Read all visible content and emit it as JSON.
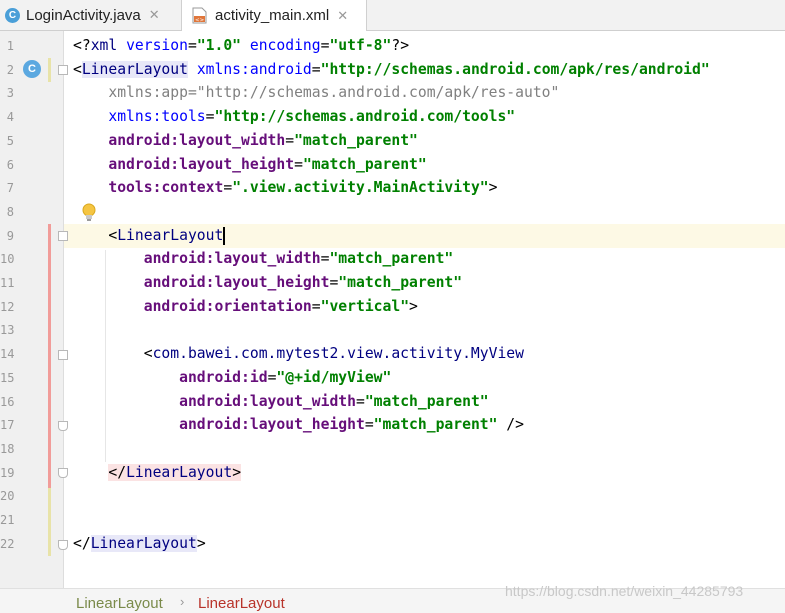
{
  "tabs": [
    {
      "label": "LoginActivity.java",
      "icon": "java-class-icon",
      "active": false
    },
    {
      "label": "activity_main.xml",
      "icon": "xml-file-icon",
      "active": true
    }
  ],
  "lines": [
    {
      "num": "1",
      "parts": [
        {
          "t": "<?",
          "c": "punc"
        },
        {
          "t": "xml ",
          "c": "tag"
        },
        {
          "t": "version",
          "c": "attr"
        },
        {
          "t": "=",
          "c": "punc"
        },
        {
          "t": "\"1.0\"",
          "c": "val"
        },
        {
          "t": " ",
          "c": "punc"
        },
        {
          "t": "encoding",
          "c": "attr"
        },
        {
          "t": "=",
          "c": "punc"
        },
        {
          "t": "\"utf-8\"",
          "c": "val"
        },
        {
          "t": "?>",
          "c": "punc"
        }
      ]
    },
    {
      "num": "2",
      "parts": [
        {
          "t": "<",
          "c": "punc"
        },
        {
          "t": "LinearLayout",
          "c": "tag",
          "bg": "tagbg"
        },
        {
          "t": " ",
          "c": "punc"
        },
        {
          "t": "xmlns:android",
          "c": "attr"
        },
        {
          "t": "=",
          "c": "punc"
        },
        {
          "t": "\"http://schemas.android.com/apk/res/android\"",
          "c": "val"
        }
      ]
    },
    {
      "num": "3",
      "parts": [
        {
          "t": "    xmlns:app=\"http://schemas.android.com/apk/res-auto\"",
          "c": "gray"
        }
      ]
    },
    {
      "num": "4",
      "parts": [
        {
          "t": "    ",
          "c": "punc"
        },
        {
          "t": "xmlns:tools",
          "c": "attr"
        },
        {
          "t": "=",
          "c": "punc"
        },
        {
          "t": "\"http://schemas.android.com/tools\"",
          "c": "val"
        }
      ]
    },
    {
      "num": "5",
      "parts": [
        {
          "t": "    ",
          "c": "punc"
        },
        {
          "t": "android:",
          "c": "attrns"
        },
        {
          "t": "layout_width",
          "c": "attrns"
        },
        {
          "t": "=",
          "c": "punc"
        },
        {
          "t": "\"match_parent\"",
          "c": "val"
        }
      ]
    },
    {
      "num": "6",
      "parts": [
        {
          "t": "    ",
          "c": "punc"
        },
        {
          "t": "android:",
          "c": "attrns"
        },
        {
          "t": "layout_height",
          "c": "attrns"
        },
        {
          "t": "=",
          "c": "punc"
        },
        {
          "t": "\"match_parent\"",
          "c": "val"
        }
      ]
    },
    {
      "num": "7",
      "parts": [
        {
          "t": "    ",
          "c": "punc"
        },
        {
          "t": "tools:",
          "c": "attrns"
        },
        {
          "t": "context",
          "c": "attrns"
        },
        {
          "t": "=",
          "c": "punc"
        },
        {
          "t": "\".view.activity.MainActivity\"",
          "c": "val"
        },
        {
          "t": ">",
          "c": "punc"
        }
      ]
    },
    {
      "num": "8",
      "parts": []
    },
    {
      "num": "9",
      "parts": [
        {
          "t": "    <",
          "c": "punc"
        },
        {
          "t": "LinearLayout",
          "c": "tag"
        },
        {
          "t": "",
          "c": "caret"
        }
      ]
    },
    {
      "num": "10",
      "parts": [
        {
          "t": "        ",
          "c": "punc"
        },
        {
          "t": "android:layout_width",
          "c": "attrns"
        },
        {
          "t": "=",
          "c": "punc"
        },
        {
          "t": "\"match_parent\"",
          "c": "val"
        }
      ]
    },
    {
      "num": "11",
      "parts": [
        {
          "t": "        ",
          "c": "punc"
        },
        {
          "t": "android:layout_height",
          "c": "attrns"
        },
        {
          "t": "=",
          "c": "punc"
        },
        {
          "t": "\"match_parent\"",
          "c": "val"
        }
      ]
    },
    {
      "num": "12",
      "parts": [
        {
          "t": "        ",
          "c": "punc"
        },
        {
          "t": "android:orientation",
          "c": "attrns"
        },
        {
          "t": "=",
          "c": "punc"
        },
        {
          "t": "\"vertical\"",
          "c": "val"
        },
        {
          "t": ">",
          "c": "punc"
        }
      ]
    },
    {
      "num": "13",
      "parts": []
    },
    {
      "num": "14",
      "parts": [
        {
          "t": "        <",
          "c": "punc"
        },
        {
          "t": "com.bawei.com.mytest2.view.activity.MyView",
          "c": "tag"
        }
      ]
    },
    {
      "num": "15",
      "parts": [
        {
          "t": "            ",
          "c": "punc"
        },
        {
          "t": "android:id",
          "c": "attrns"
        },
        {
          "t": "=",
          "c": "punc"
        },
        {
          "t": "\"@+id/myView\"",
          "c": "val"
        }
      ]
    },
    {
      "num": "16",
      "parts": [
        {
          "t": "            ",
          "c": "punc"
        },
        {
          "t": "android:layout_width",
          "c": "attrns"
        },
        {
          "t": "=",
          "c": "punc"
        },
        {
          "t": "\"match_parent\"",
          "c": "val"
        }
      ]
    },
    {
      "num": "17",
      "parts": [
        {
          "t": "            ",
          "c": "punc"
        },
        {
          "t": "android:layout_height",
          "c": "attrns"
        },
        {
          "t": "=",
          "c": "punc"
        },
        {
          "t": "\"match_parent\"",
          "c": "val"
        },
        {
          "t": " />",
          "c": "punc"
        }
      ]
    },
    {
      "num": "18",
      "parts": []
    },
    {
      "num": "19",
      "parts": [
        {
          "t": "    ",
          "c": "punc"
        },
        {
          "t": "</",
          "c": "punc",
          "bg": "tagbg-red"
        },
        {
          "t": "LinearLayout",
          "c": "tag",
          "bg": "tagbg-red"
        },
        {
          "t": ">",
          "c": "punc",
          "bg": "tagbg-red"
        }
      ]
    },
    {
      "num": "20",
      "parts": []
    },
    {
      "num": "21",
      "parts": []
    },
    {
      "num": "22",
      "parts": [
        {
          "t": "</",
          "c": "punc"
        },
        {
          "t": "LinearLayout",
          "c": "tag",
          "bg": "tagbg"
        },
        {
          "t": ">",
          "c": "punc"
        }
      ]
    }
  ],
  "breadcrumb": [
    "LinearLayout",
    "LinearLayout"
  ],
  "breadcrumb_separator": "›",
  "watermark": "https://blog.csdn.net/weixin_44285793"
}
